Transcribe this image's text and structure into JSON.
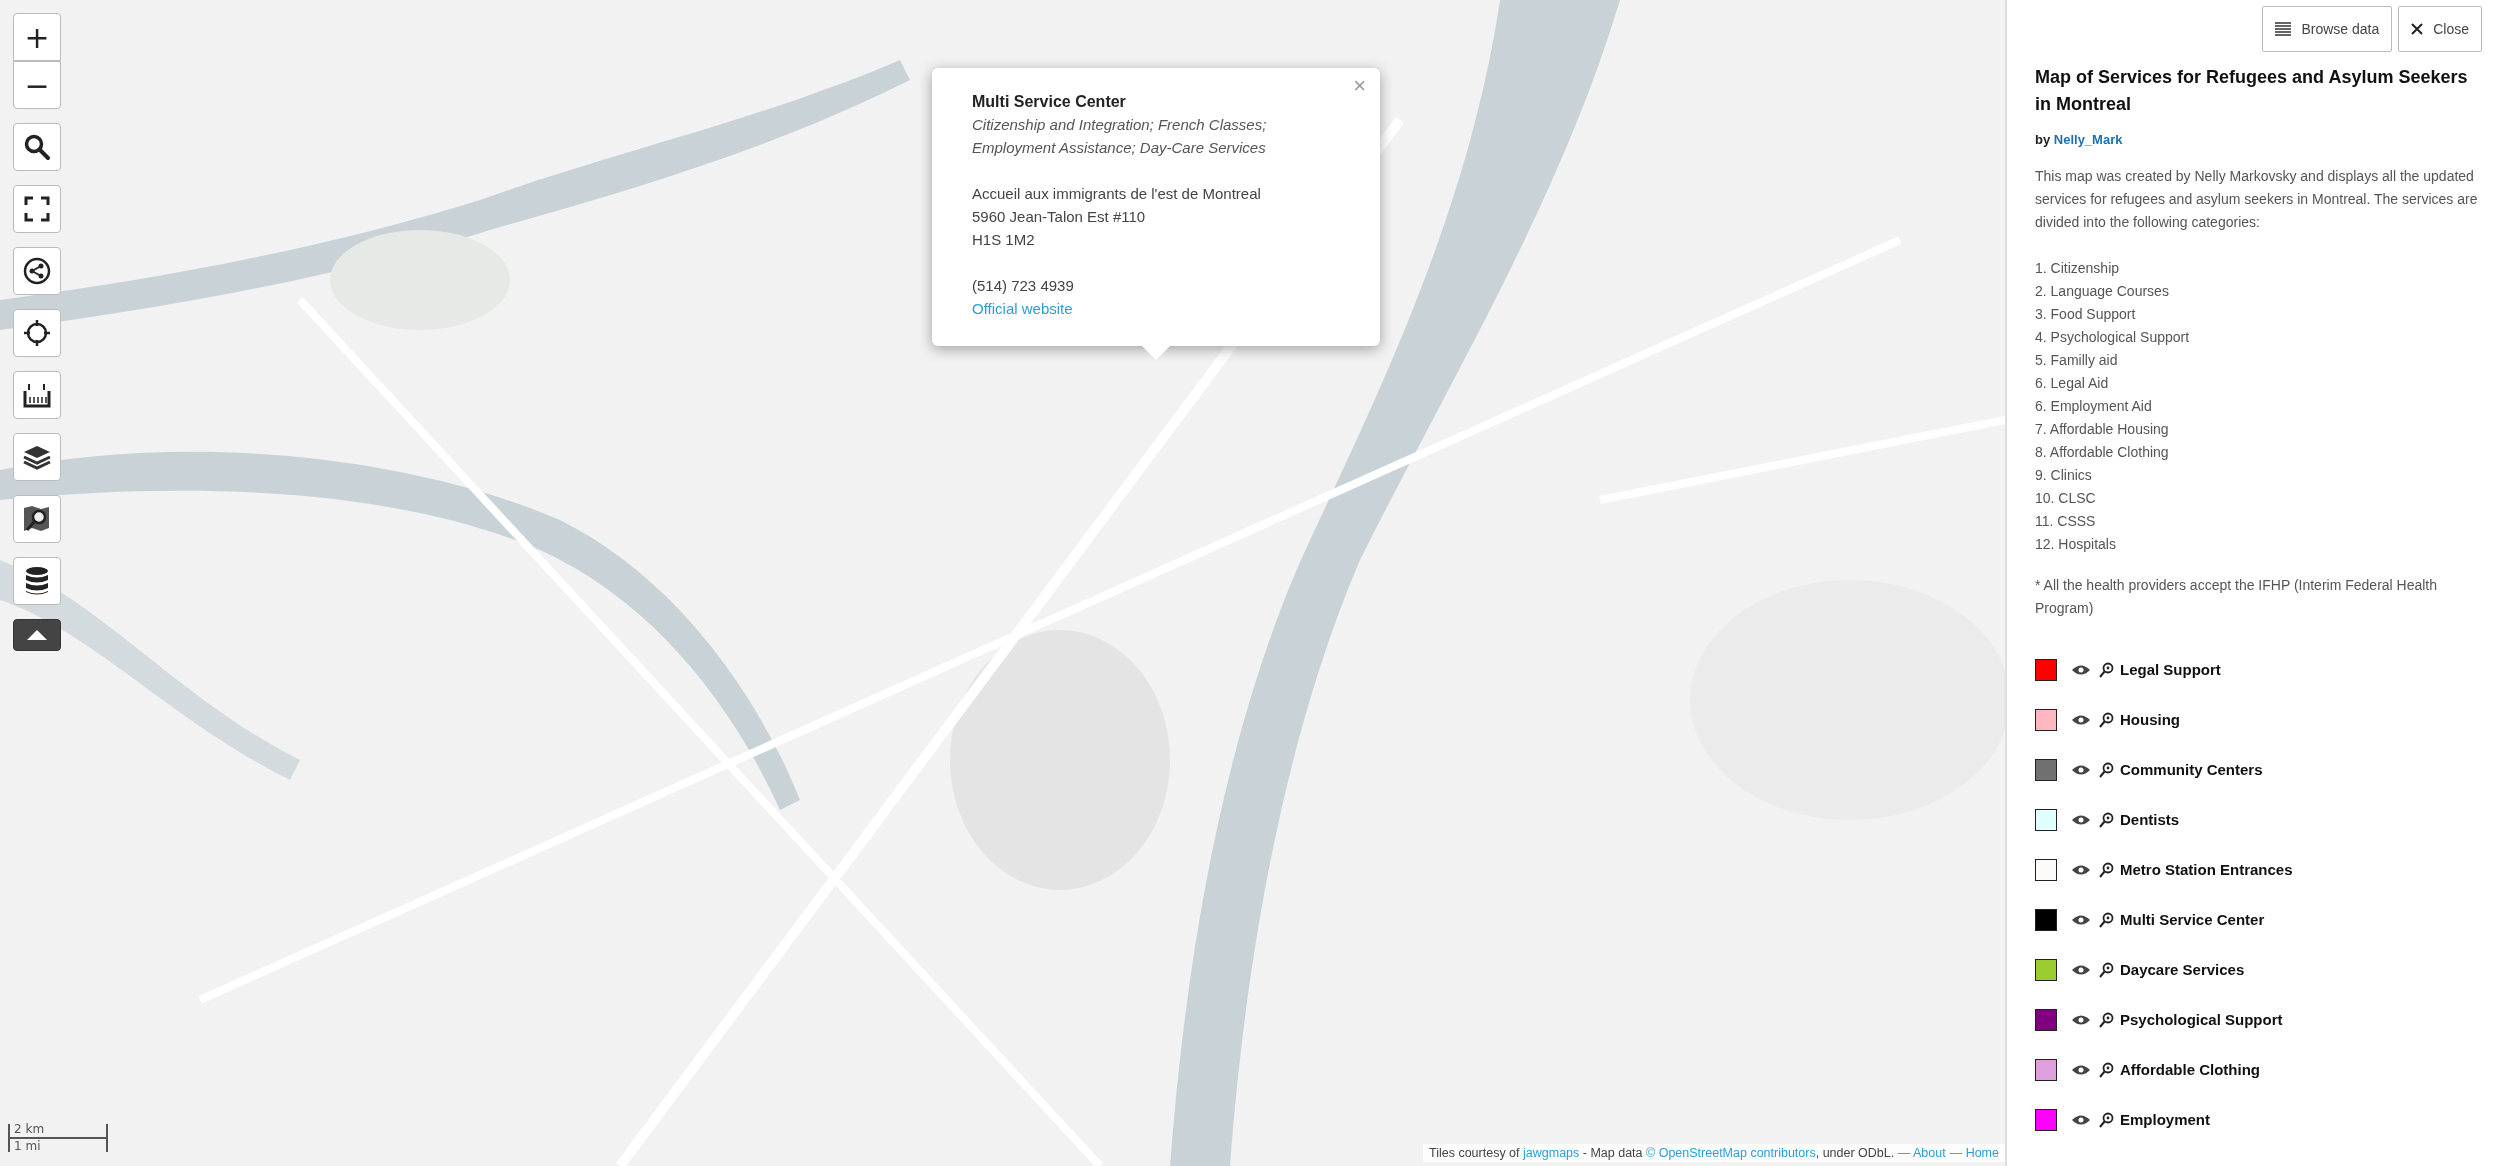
{
  "map": {
    "kind": "picture",
    "controls": [
      {
        "kind": "zoom_in",
        "label": "+"
      },
      {
        "kind": "zoom_out",
        "label": "−"
      },
      {
        "kind": "search"
      },
      {
        "kind": "fullscreen"
      },
      {
        "kind": "share"
      },
      {
        "kind": "locate"
      },
      {
        "kind": "measure"
      },
      {
        "kind": "layers"
      },
      {
        "kind": "edit_map"
      },
      {
        "kind": "data"
      },
      {
        "kind": "collapse"
      }
    ],
    "popup": {
      "title": "Multi Service Center",
      "categories": "Citizenship and Integration; French Classes; Employment Assistance; Day-Care Services",
      "address": [
        "Accueil aux immigrants de l'est de Montreal",
        "5960 Jean-Talon Est #110",
        "H1S 1M2"
      ],
      "phone": "(514) 723 4939",
      "link": "Official website",
      "close": "×"
    },
    "scale": {
      "metric": "2 km",
      "imperial": "1 mi"
    },
    "attribution": [
      {
        "kind": "text",
        "text": "Tiles courtesy of "
      },
      {
        "kind": "link",
        "text": "jawgmaps"
      },
      {
        "kind": "text",
        "text": " - Map data "
      },
      {
        "kind": "link",
        "text": "© OpenStreetMap contributors"
      },
      {
        "kind": "text",
        "text": ", under ODbL. "
      },
      {
        "kind": "link",
        "text": "— About"
      },
      {
        "kind": "link",
        "text": "— Home"
      }
    ]
  },
  "sidebar": {
    "buttons": [
      {
        "kind": "browse",
        "label": "Browse data"
      },
      {
        "kind": "close",
        "label": "Close"
      }
    ],
    "title": "Map of Services for Refugees and Asylum Seekers in Montreal",
    "byline": {
      "prefix": "by",
      "author": "Nelly_Mark"
    },
    "description": "This map was created by Nelly Markovsky and displays all the updated services for refugees and asylum seekers in Montreal. The services are divided into the following categories:",
    "categories": [
      "1. Citizenship",
      "2. Language Courses",
      "3. Food Support",
      "4. Psychological Support",
      "5. Familly aid",
      "6. Legal Aid",
      "6. Employment Aid",
      "7. Affordable Housing",
      "8. Affordable Clothing",
      "9. Clinics",
      "10. CLSC",
      "11. CSSS",
      "12. Hospitals"
    ],
    "note": "* All the health providers accept the IFHP (Interim Federal Health Program)",
    "layers": [
      {
        "name": "Legal Support",
        "color": "#ff0000"
      },
      {
        "name": "Housing",
        "color": "#ffb6c1"
      },
      {
        "name": "Community Centers",
        "color": "#707070"
      },
      {
        "name": "Dentists",
        "color": "#e0ffff"
      },
      {
        "name": "Metro Station Entrances",
        "color": "#fdfafa"
      },
      {
        "name": "Multi Service Center",
        "color": "#000000"
      },
      {
        "name": "Daycare Services",
        "color": "#9acd32"
      },
      {
        "name": "Psychological Support",
        "color": "#800080"
      },
      {
        "name": "Affordable Clothing",
        "color": "#dda0dd"
      },
      {
        "name": "Employment",
        "color": "#ff00ff"
      }
    ]
  }
}
